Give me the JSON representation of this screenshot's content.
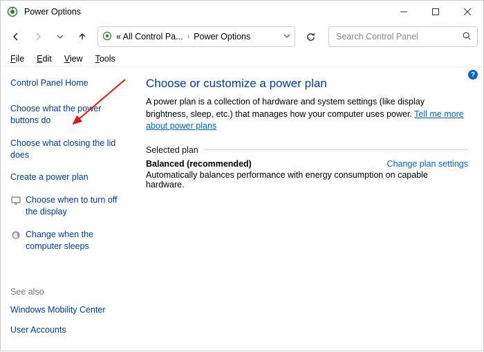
{
  "titlebar": {
    "title": "Power Options"
  },
  "menubar": [
    {
      "key": "F",
      "rest": "ile"
    },
    {
      "key": "E",
      "rest": "dit"
    },
    {
      "key": "V",
      "rest": "iew"
    },
    {
      "key": "T",
      "rest": "ools"
    }
  ],
  "address": {
    "crumb1": "« All Control Pa...",
    "crumb2": "Power Options"
  },
  "search": {
    "placeholder": "Search Control Panel"
  },
  "sidebar": {
    "home": "Control Panel Home",
    "links": [
      "Choose what the power buttons do",
      "Choose what closing the lid does",
      "Create a power plan"
    ],
    "icon_links": [
      "Choose when to turn off the display",
      "Change when the computer sleeps"
    ],
    "see_also_label": "See also",
    "see_also": [
      "Windows Mobility Center",
      "User Accounts"
    ]
  },
  "main": {
    "title": "Choose or customize a power plan",
    "desc_a": "A power plan is a collection of hardware and system settings (like display brightness, sleep, etc.) that manages how your computer uses power. ",
    "desc_link": "Tell me more about power plans",
    "section": "Selected plan",
    "plan_name": "Balanced (recommended)",
    "plan_change": "Change plan settings",
    "plan_sub": "Automatically balances performance with energy consumption on capable hardware."
  }
}
